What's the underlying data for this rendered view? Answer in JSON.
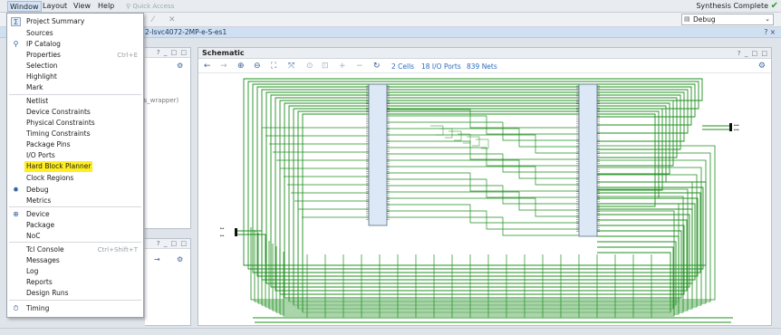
{
  "menubar": {
    "items": [
      {
        "label": "Window",
        "accel": "W",
        "rest": "indow"
      },
      {
        "label": "Layout",
        "accel": "",
        "rest": "Layout"
      },
      {
        "label": "View",
        "accel": "V",
        "rest": "iew"
      },
      {
        "label": "Help",
        "accel": "H",
        "rest": "elp"
      }
    ],
    "quick_access": "Quick Access",
    "status": "Synthesis Complete",
    "status_icon": "checkmark-icon"
  },
  "toolbar": {
    "layout_value": "Debug"
  },
  "project_bar": {
    "title": "2-lsvc4072-2MP-e-S-es1",
    "buttons": "? ×"
  },
  "left_top_panel": {
    "buttons": "? _ □ □",
    "partial_text": "ps_wrapper)"
  },
  "left_bottom_panel": {
    "buttons": "? _ □ □"
  },
  "schematic": {
    "title": "Schematic",
    "buttons": "? _ □ □",
    "cells_link": "2 Cells",
    "ports_link": "18 I/O Ports",
    "nets_link": "839 Nets",
    "wire_color": "#1f8f1f",
    "cell_fill": "#dce8f5"
  },
  "window_menu": {
    "items": [
      {
        "label": "Project Summary",
        "shortcut": "",
        "icon": "sigma-icon",
        "highlight": false
      },
      {
        "label": "Sources",
        "shortcut": "",
        "icon": "",
        "highlight": false
      },
      {
        "label": "IP Catalog",
        "shortcut": "",
        "icon": "ip-catalog-icon",
        "highlight": false
      },
      {
        "label": "Properties",
        "shortcut": "Ctrl+E",
        "icon": "",
        "highlight": false
      },
      {
        "label": "Selection",
        "shortcut": "",
        "icon": "",
        "highlight": false
      },
      {
        "label": "Highlight",
        "shortcut": "",
        "icon": "",
        "highlight": false
      },
      {
        "label": "Mark",
        "shortcut": "",
        "icon": "",
        "highlight": false
      },
      {
        "label": "Netlist",
        "shortcut": "",
        "icon": "",
        "highlight": false
      },
      {
        "label": "Device Constraints",
        "shortcut": "",
        "icon": "",
        "highlight": false
      },
      {
        "label": "Physical Constraints",
        "shortcut": "",
        "icon": "",
        "highlight": false
      },
      {
        "label": "Timing Constraints",
        "shortcut": "",
        "icon": "",
        "highlight": false
      },
      {
        "label": "Package Pins",
        "shortcut": "",
        "icon": "",
        "highlight": false
      },
      {
        "label": "I/O Ports",
        "shortcut": "",
        "icon": "",
        "highlight": false
      },
      {
        "label": "Hard Block Planner",
        "shortcut": "",
        "icon": "",
        "highlight": true
      },
      {
        "label": "Clock Regions",
        "shortcut": "",
        "icon": "",
        "highlight": false
      },
      {
        "label": "Debug",
        "shortcut": "",
        "icon": "bug-icon",
        "highlight": false
      },
      {
        "label": "Metrics",
        "shortcut": "",
        "icon": "",
        "highlight": false
      },
      {
        "label": "Device",
        "shortcut": "",
        "icon": "device-icon",
        "highlight": false
      },
      {
        "label": "Package",
        "shortcut": "",
        "icon": "",
        "highlight": false
      },
      {
        "label": "NoC",
        "shortcut": "",
        "icon": "",
        "highlight": false
      },
      {
        "label": "Tcl Console",
        "shortcut": "Ctrl+Shift+T",
        "icon": "",
        "highlight": false
      },
      {
        "label": "Messages",
        "shortcut": "",
        "icon": "",
        "highlight": false
      },
      {
        "label": "Log",
        "shortcut": "",
        "icon": "",
        "highlight": false
      },
      {
        "label": "Reports",
        "shortcut": "",
        "icon": "",
        "highlight": false
      },
      {
        "label": "Design Runs",
        "shortcut": "",
        "icon": "",
        "highlight": false
      },
      {
        "label": "Timing",
        "shortcut": "",
        "icon": "timing-icon",
        "highlight": false
      }
    ]
  }
}
